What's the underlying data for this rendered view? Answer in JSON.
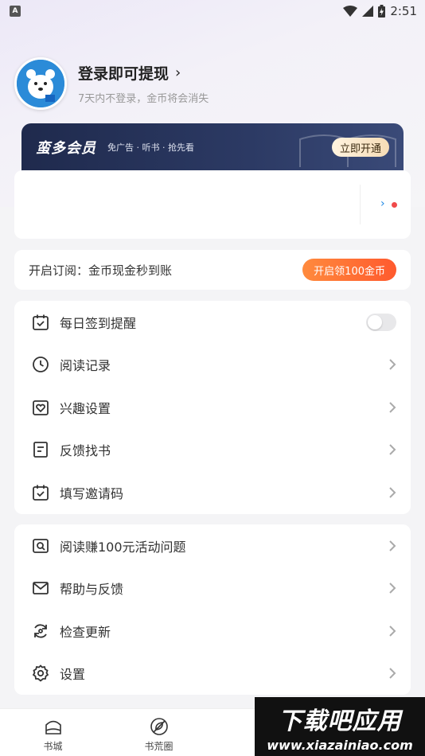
{
  "status_bar": {
    "notif_badge": "A",
    "time": "2:51"
  },
  "profile": {
    "title": "登录即可提现",
    "chevron": "›",
    "subtitle": "7天内不登录，金币将会消失"
  },
  "vip": {
    "logo": "蛮多会员",
    "desc": "免广告 · 听书 · 抢先看",
    "button": "立即开通"
  },
  "blank_card": {
    "arrow": "›"
  },
  "subscribe": {
    "text": "开启订阅：金币现金秒到账",
    "button": "开启领100金币"
  },
  "menu_group1": [
    {
      "label": "每日签到提醒",
      "icon": "calendar-check-icon",
      "control": "toggle",
      "toggle_on": false
    },
    {
      "label": "阅读记录",
      "icon": "clock-icon",
      "control": "chevron"
    },
    {
      "label": "兴趣设置",
      "icon": "heart-box-icon",
      "control": "chevron"
    },
    {
      "label": "反馈找书",
      "icon": "document-icon",
      "control": "chevron"
    },
    {
      "label": "填写邀请码",
      "icon": "calendar-check-icon",
      "control": "chevron"
    }
  ],
  "menu_group2": [
    {
      "label": "阅读赚100元活动问题",
      "icon": "search-box-icon",
      "control": "chevron"
    },
    {
      "label": "帮助与反馈",
      "icon": "mail-icon",
      "control": "chevron"
    },
    {
      "label": "检查更新",
      "icon": "refresh-icon",
      "control": "chevron"
    },
    {
      "label": "设置",
      "icon": "gear-icon",
      "control": "chevron"
    }
  ],
  "bottom_nav": [
    {
      "label": "书城",
      "icon": "bookstore-icon"
    },
    {
      "label": "书荒圈",
      "icon": "leaf-icon"
    }
  ],
  "watermark": {
    "main": "下载吧应用",
    "url": "www.xiazainiao.com"
  },
  "colors": {
    "accent_orange": "#ff5a2e",
    "vip_dark": "#1f2a4d",
    "link_blue": "#1e88e5",
    "dot_red": "#f04a4a"
  }
}
